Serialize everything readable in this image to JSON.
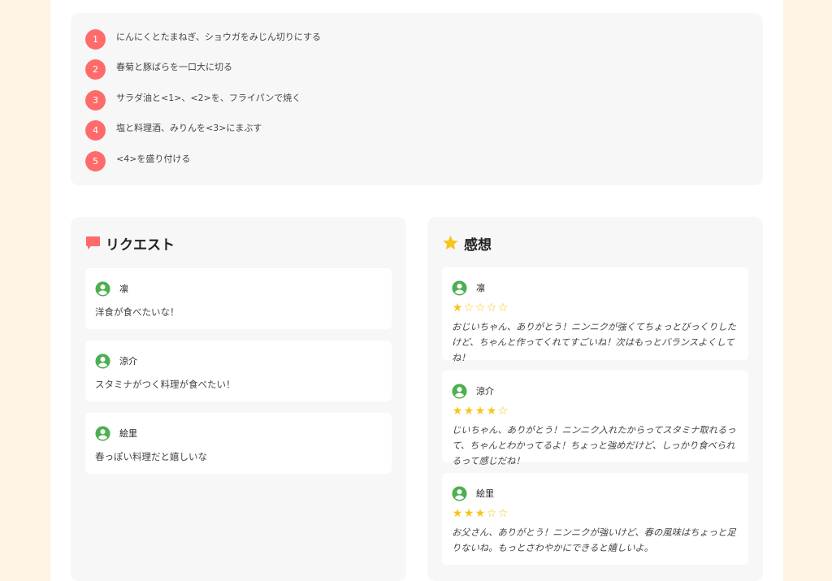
{
  "steps": [
    {
      "num": "1",
      "text": "にんにくとたまねぎ、ショウガをみじん切りにする"
    },
    {
      "num": "2",
      "text": "春菊と豚ばらを一口大に切る"
    },
    {
      "num": "3",
      "text": "サラダ油と<1>、<2>を、フライパンで焼く"
    },
    {
      "num": "4",
      "text": "塩と料理酒、みりんを<3>にまぶす"
    },
    {
      "num": "5",
      "text": "<4>を盛り付ける"
    }
  ],
  "requests": {
    "title": "リクエスト",
    "icon": "chat-bubble-icon",
    "items": [
      {
        "user": "凛",
        "text": "洋食が食べたいな！"
      },
      {
        "user": "涼介",
        "text": "スタミナがつく料理が食べたい！"
      },
      {
        "user": "絵里",
        "text": "春っぽい料理だと嬉しいな"
      }
    ]
  },
  "reviews": {
    "title": "感想",
    "icon": "star-icon",
    "items": [
      {
        "user": "凛",
        "rating": 1,
        "max": 5,
        "text": "おじいちゃん、ありがとう！ニンニクが強くてちょっとびっくりしたけど、ちゃんと作ってくれてすごいね！次はもっとバランスよくしてね！"
      },
      {
        "user": "涼介",
        "rating": 4,
        "max": 5,
        "text": "じいちゃん、ありがとう！ニンニク入れたからってスタミナ取れるって、ちゃんとわかってるよ！ちょっと強めだけど、しっかり食べられるって感じだね！"
      },
      {
        "user": "絵里",
        "rating": 3,
        "max": 5,
        "text": "お父さん、ありがとう！ニンニクが強いけど、春の風味はちょっと足りないね。もっとさわやかにできると嬉しいよ。"
      }
    ]
  },
  "colors": {
    "accent": "#ff6b6b",
    "avatar": "#4caf50",
    "star": "#f5c518",
    "background": "#fff4e3"
  }
}
